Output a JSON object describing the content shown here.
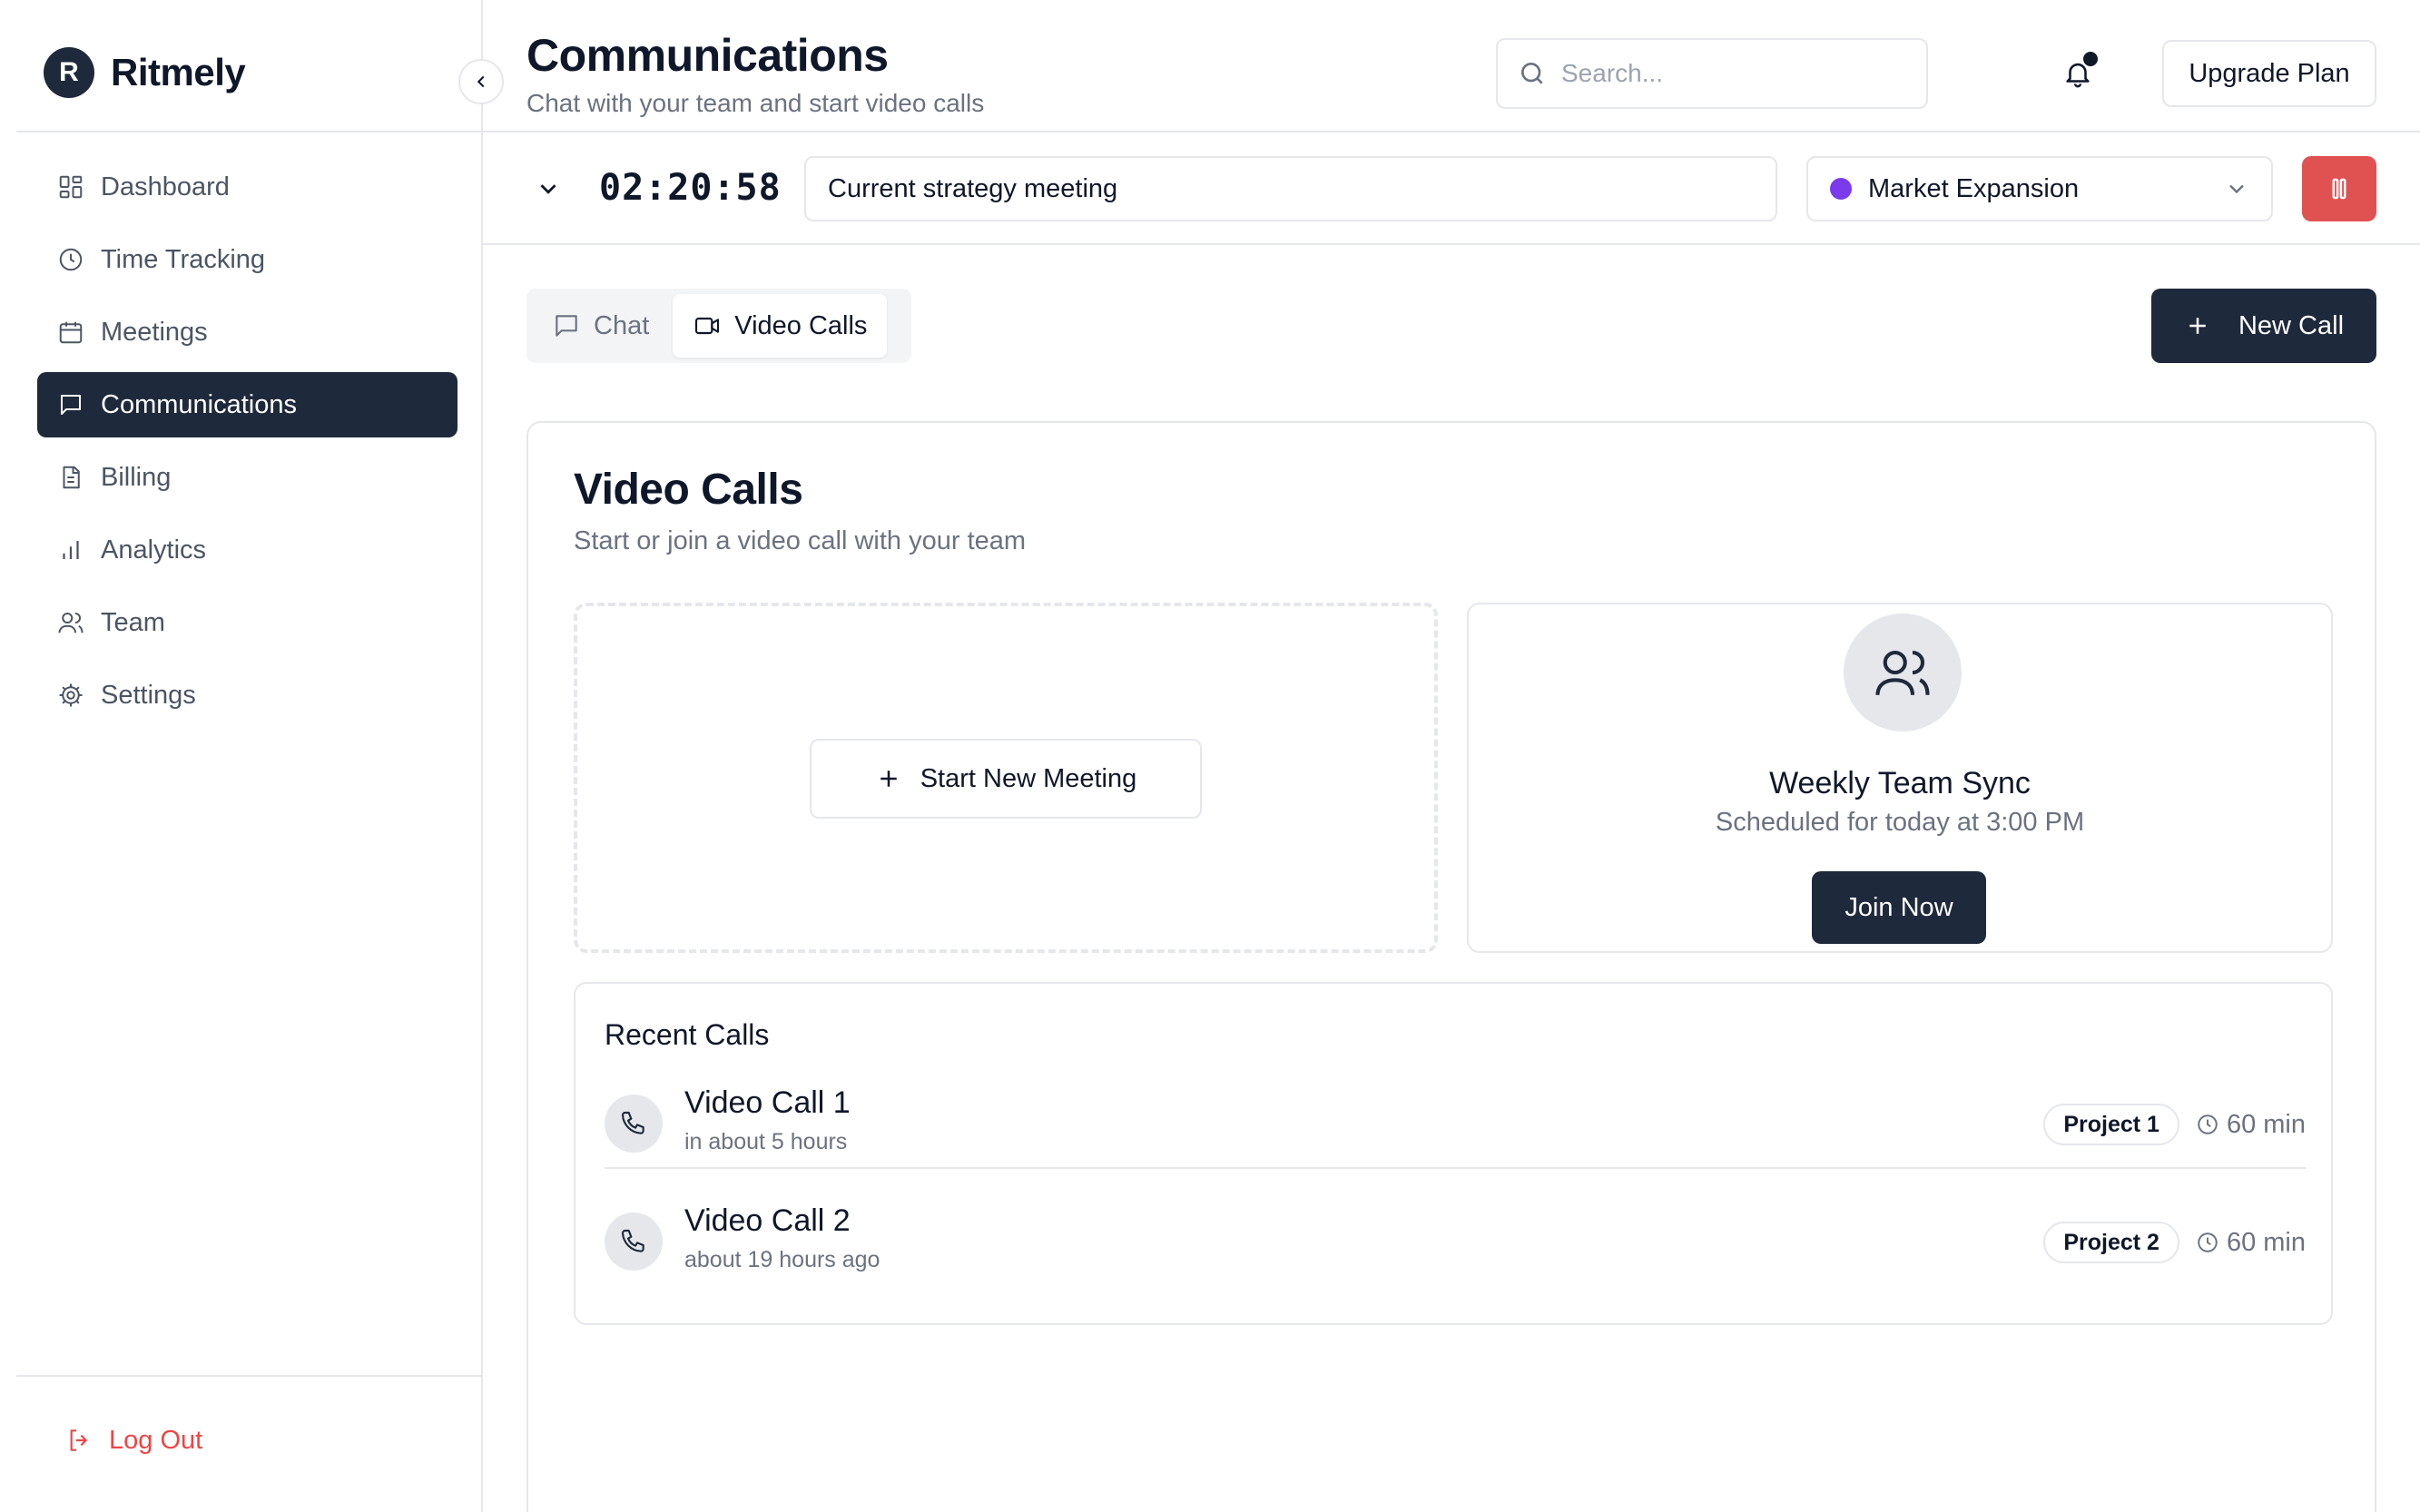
{
  "brand": {
    "logo_letter": "R",
    "name": "Ritmely"
  },
  "sidebar": {
    "items": [
      {
        "label": "Dashboard",
        "icon": "dashboard-icon",
        "active": false
      },
      {
        "label": "Time Tracking",
        "icon": "clock-icon",
        "active": false
      },
      {
        "label": "Meetings",
        "icon": "calendar-icon",
        "active": false
      },
      {
        "label": "Communications",
        "icon": "message-square-icon",
        "active": true
      },
      {
        "label": "Billing",
        "icon": "file-text-icon",
        "active": false
      },
      {
        "label": "Analytics",
        "icon": "bar-chart-icon",
        "active": false
      },
      {
        "label": "Team",
        "icon": "users-icon",
        "active": false
      },
      {
        "label": "Settings",
        "icon": "gear-icon",
        "active": false
      }
    ],
    "logout_label": "Log Out"
  },
  "header": {
    "title": "Communications",
    "subtitle": "Chat with your team and start video calls",
    "search_placeholder": "Search...",
    "upgrade_label": "Upgrade Plan"
  },
  "timer": {
    "elapsed": "02:20:58",
    "description": "Current strategy meeting",
    "project": "Market Expansion",
    "project_color": "#7c3aed",
    "stop_color": "#e05252"
  },
  "tabs": [
    {
      "label": "Chat",
      "active": false
    },
    {
      "label": "Video Calls",
      "active": true
    }
  ],
  "new_call_label": "New Call",
  "video_calls": {
    "title": "Video Calls",
    "subtitle": "Start or join a video call with your team",
    "start_label": "Start New Meeting",
    "scheduled": {
      "name": "Weekly Team Sync",
      "time": "Scheduled for today at 3:00 PM",
      "join_label": "Join Now"
    },
    "recent": {
      "title": "Recent Calls",
      "calls": [
        {
          "name": "Video Call 1",
          "time": "in about 5 hours",
          "project": "Project 1",
          "duration": "60 min"
        },
        {
          "name": "Video Call 2",
          "time": "about 19 hours ago",
          "project": "Project 2",
          "duration": "60 min"
        }
      ]
    }
  },
  "colors": {
    "primary": "#1e293b",
    "danger": "#ef4444",
    "border": "#e5e7eb",
    "muted": "#6b7280"
  }
}
